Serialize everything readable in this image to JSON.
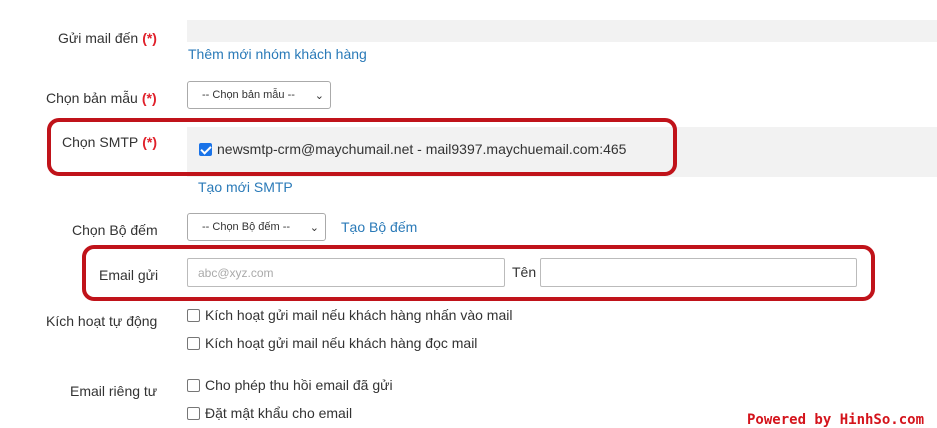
{
  "form": {
    "send_to": {
      "label": "Gửi mail đến",
      "required_mark": "(*)",
      "add_group_link": "Thêm mới nhóm khách hàng"
    },
    "template": {
      "label": "Chọn bản mẫu",
      "required_mark": "(*)",
      "selected": "-- Chọn bản mẫu --"
    },
    "smtp": {
      "label": "Chọn SMTP",
      "required_mark": "(*)",
      "option_label": "newsmtp-crm@maychumail.net - mail9397.maychuemail.com:465",
      "option_checked": true,
      "create_link": "Tạo mới SMTP"
    },
    "counter": {
      "label": "Chọn Bộ đếm",
      "selected": "-- Chọn Bộ đếm --",
      "create_link": "Tạo Bộ đếm"
    },
    "sender": {
      "label": "Email gửi",
      "email_placeholder": "abc@xyz.com",
      "email_value": "",
      "name_label": "Tên",
      "name_value": ""
    },
    "auto": {
      "label": "Kích hoạt tự động",
      "options": [
        "Kích hoạt gửi mail nếu khách hàng nhấn vào mail",
        "Kích hoạt gửi mail nếu khách hàng đọc mail"
      ]
    },
    "privacy": {
      "label": "Email riêng tư",
      "options": [
        "Cho phép thu hồi email đã gửi",
        "Đặt mật khẩu cho email"
      ]
    }
  },
  "watermark": "Powered by HinhSo.com",
  "colors": {
    "highlight": "#c0131a",
    "link": "#2a7ab8",
    "required": "#e0202a",
    "field_bg": "#f2f2f2"
  }
}
